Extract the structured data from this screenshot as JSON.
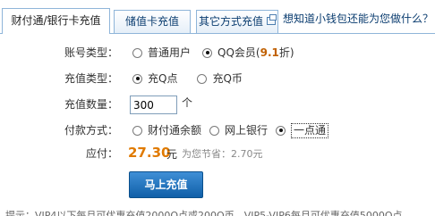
{
  "tabs": [
    {
      "label": "财付通/银行卡充值",
      "active": true
    },
    {
      "label": "储值卡充值",
      "active": false
    },
    {
      "label": "其它方式充值",
      "active": false,
      "icon": "external-window-icon"
    }
  ],
  "promo_link": "想知道小钱包还能为您做什么？",
  "form": {
    "account_type": {
      "label": "账号类型：",
      "options": [
        {
          "label": "普通用户",
          "checked": false
        },
        {
          "label": "QQ会员",
          "discount": "9.1",
          "discount_suffix": "折",
          "checked": true
        }
      ]
    },
    "recharge_type": {
      "label": "充值类型：",
      "options": [
        {
          "label": "充Q点",
          "checked": true
        },
        {
          "label": "充Q币",
          "checked": false
        }
      ]
    },
    "quantity": {
      "label": "充值数量：",
      "value": "300",
      "unit": "个"
    },
    "payment": {
      "label": "付款方式：",
      "options": [
        {
          "label": "财付通余额",
          "checked": false
        },
        {
          "label": "网上银行",
          "checked": false
        },
        {
          "label": "一点通",
          "checked": true
        }
      ]
    },
    "payable": {
      "label": "应付：",
      "amount": "27.30",
      "currency": "元",
      "saving_prefix": "为您节省：",
      "saving": "2.70元"
    },
    "submit_label": "马上充值"
  },
  "hint": "提示：VIP4以下每月可优惠充值2000Q点或200Q币，VIP5-VIP6每月可优惠充值5000Q点"
}
